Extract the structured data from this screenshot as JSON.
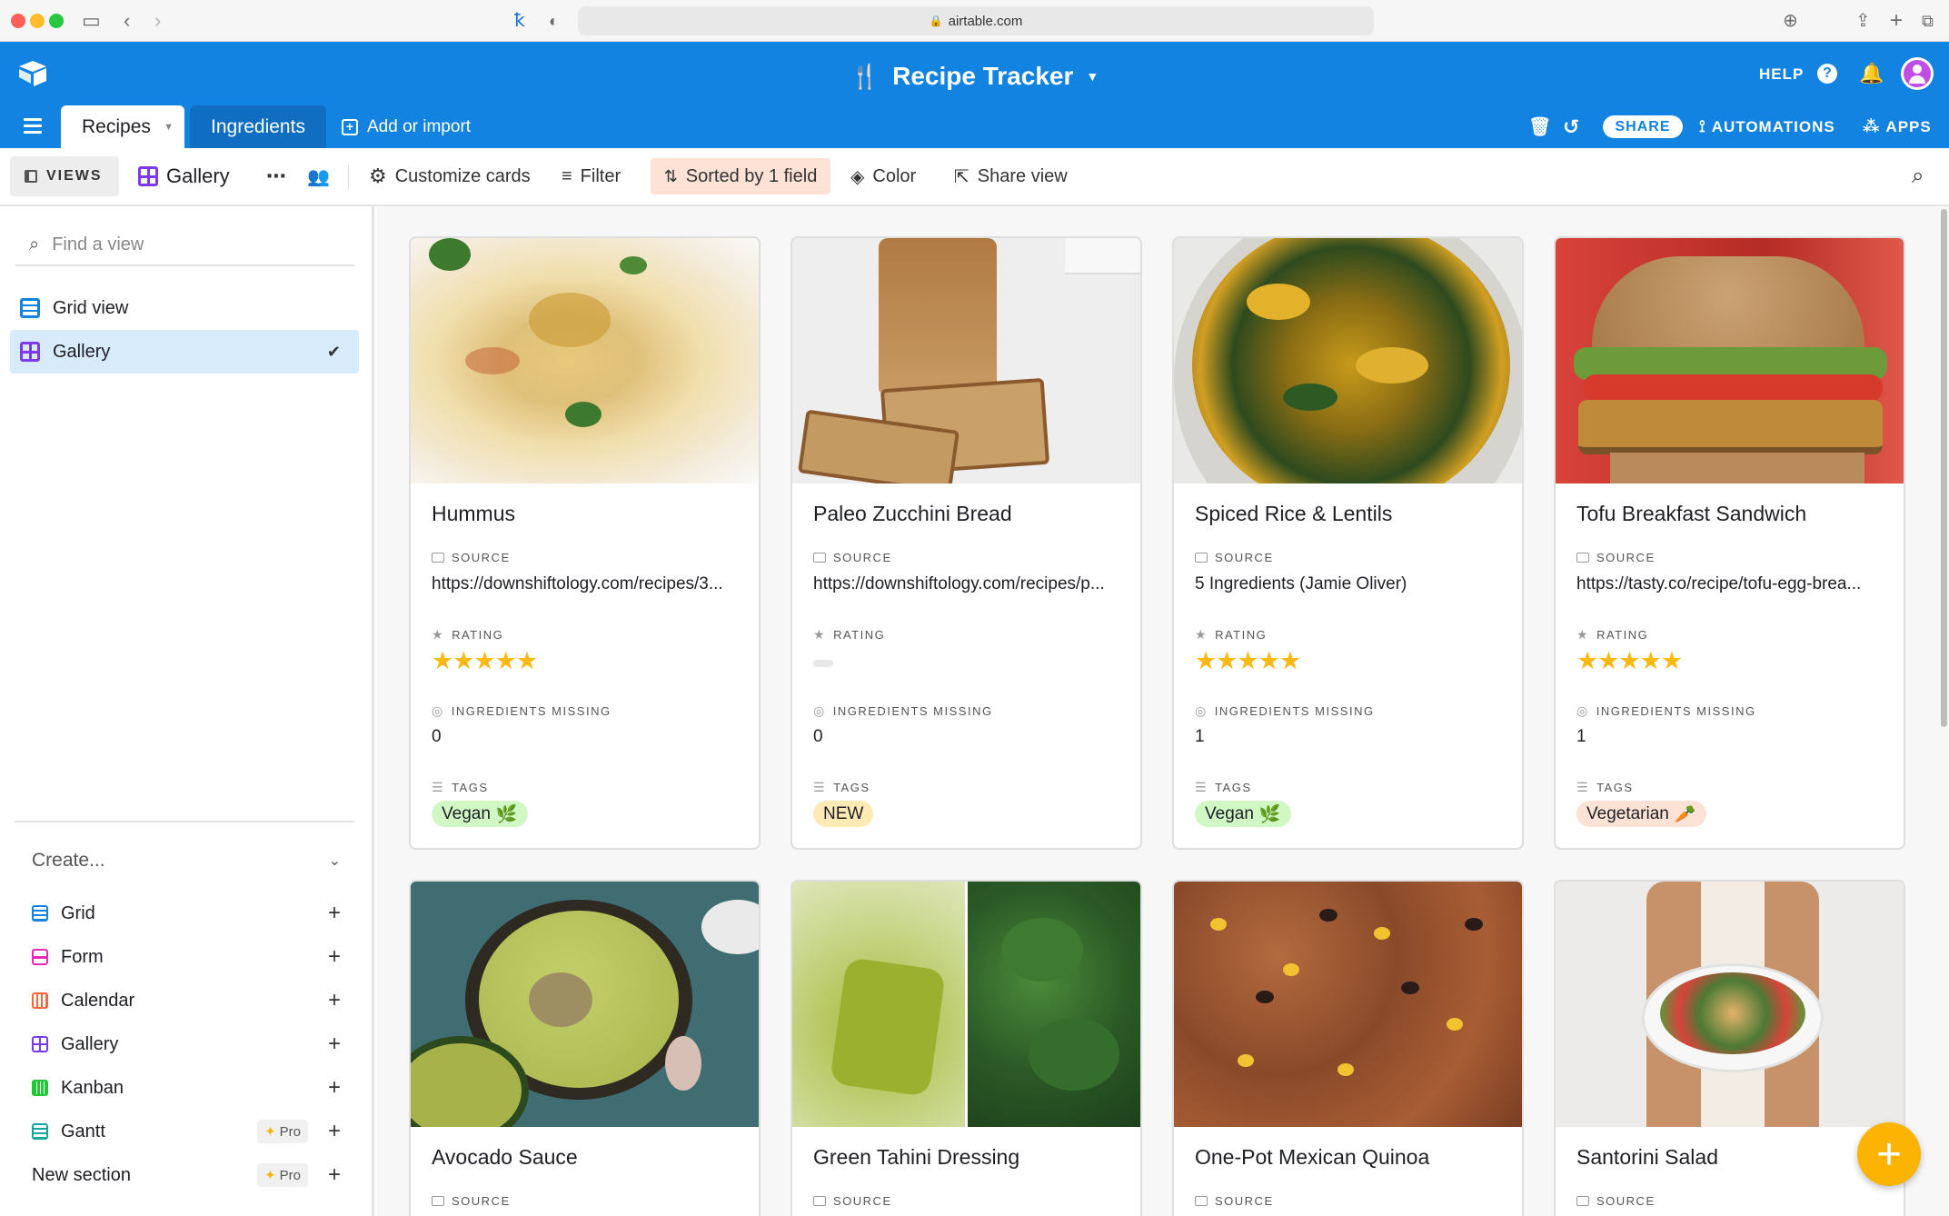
{
  "browser": {
    "url": "airtable.com"
  },
  "app": {
    "title": "Recipe Tracker",
    "help_label": "HELP",
    "share_label": "SHARE",
    "automations_label": "AUTOMATIONS",
    "apps_label": "APPS",
    "tabs": [
      {
        "label": "Recipes",
        "active": true
      },
      {
        "label": "Ingredients",
        "active": false
      }
    ],
    "add_import_label": "Add or import"
  },
  "toolbar": {
    "views_label": "VIEWS",
    "current_view": "Gallery",
    "customize_label": "Customize cards",
    "filter_label": "Filter",
    "sorted_label": "Sorted by 1 field",
    "color_label": "Color",
    "share_view_label": "Share view"
  },
  "sidebar": {
    "find_placeholder": "Find a view",
    "views": [
      {
        "label": "Grid view",
        "icon": "grid-icon",
        "selected": false
      },
      {
        "label": "Gallery",
        "icon": "gallery-icon",
        "selected": true
      }
    ],
    "create_label": "Create...",
    "create_items": [
      {
        "label": "Grid",
        "icon": "grid-icon",
        "color": "#1383e2"
      },
      {
        "label": "Form",
        "icon": "form-icon",
        "color": "#e929ba"
      },
      {
        "label": "Calendar",
        "icon": "calendar-icon",
        "color": "#f7653b"
      },
      {
        "label": "Gallery",
        "icon": "gallery-icon",
        "color": "#7c39ed"
      },
      {
        "label": "Kanban",
        "icon": "kanban-icon",
        "color": "#20c933"
      },
      {
        "label": "Gantt",
        "icon": "gantt-icon",
        "color": "#11a6a0",
        "pro": "Pro"
      },
      {
        "label": "New section",
        "icon": "",
        "pro": "Pro"
      }
    ]
  },
  "field_labels": {
    "source": "SOURCE",
    "rating": "RATING",
    "ingredients_missing": "INGREDIENTS MISSING",
    "tags": "TAGS"
  },
  "cards": [
    {
      "title": "Hummus",
      "source": "https://downshiftology.com/recipes/3...",
      "rating": 5,
      "ingredients_missing": "0",
      "tag": "Vegan",
      "tag_emoji": "🌿",
      "tag_color": "#d1f7c4"
    },
    {
      "title": "Paleo Zucchini Bread",
      "source": "https://downshiftology.com/recipes/p...",
      "rating": 0,
      "ingredients_missing": "0",
      "tag": "NEW",
      "tag_emoji": "",
      "tag_color": "#ffeab6"
    },
    {
      "title": "Spiced Rice & Lentils",
      "source": "5 Ingredients (Jamie Oliver)",
      "rating": 5,
      "ingredients_missing": "1",
      "tag": "Vegan",
      "tag_emoji": "🌿",
      "tag_color": "#d1f7c4"
    },
    {
      "title": "Tofu Breakfast Sandwich",
      "source": "https://tasty.co/recipe/tofu-egg-brea...",
      "rating": 5,
      "ingredients_missing": "1",
      "tag": "Vegetarian",
      "tag_emoji": "🥕",
      "tag_color": "#fee2d5"
    },
    {
      "title": "Avocado Sauce",
      "source_label_only": true
    },
    {
      "title": "Green Tahini Dressing",
      "source_label_only": true
    },
    {
      "title": "One-Pot Mexican Quinoa",
      "source_label_only": true
    },
    {
      "title": "Santorini Salad",
      "source_label_only": true
    }
  ],
  "stars_text": "★★★★★",
  "fab_label": "+"
}
